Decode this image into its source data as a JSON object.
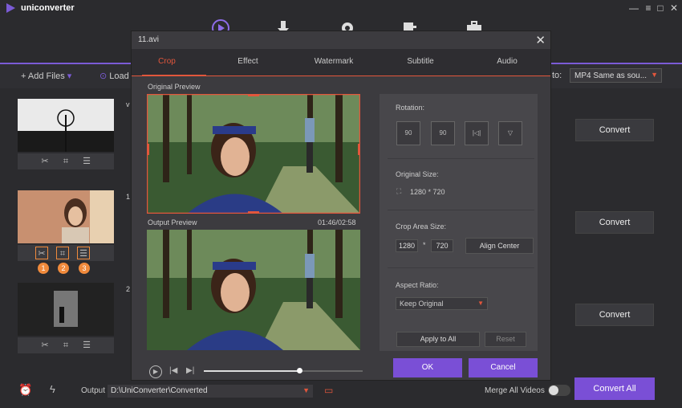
{
  "app": {
    "name": "uniconverter",
    "window_controls": [
      "—",
      "□",
      "✕"
    ]
  },
  "toolbar": {
    "add_files": "Add Files",
    "load": "Load",
    "output_to_label": "to:",
    "output_format": "MP4 Same as sou..."
  },
  "list": [
    {
      "title": "v",
      "convert": "Convert"
    },
    {
      "title": "1",
      "convert": "Convert"
    },
    {
      "title": "2",
      "convert": "Convert"
    }
  ],
  "badges": [
    "1",
    "2",
    "3"
  ],
  "dialog": {
    "title": "11.avi",
    "tabs": [
      "Crop",
      "Effect",
      "Watermark",
      "Subtitle",
      "Audio"
    ],
    "original_preview": "Original Preview",
    "output_preview": "Output Preview",
    "time": "01:46/02:58",
    "progress": 0.6,
    "rotation_label": "Rotation:",
    "rotation_buttons": [
      "90",
      "90",
      "|◁|",
      "▽"
    ],
    "original_size_label": "Original Size:",
    "original_size": "1280 * 720",
    "crop_area_label": "Crop Area Size:",
    "crop_w": "1280",
    "crop_times": "*",
    "crop_h": "720",
    "align_center": "Align Center",
    "aspect_label": "Aspect Ratio:",
    "aspect_value": "Keep Original",
    "apply_all": "Apply to All",
    "reset": "Reset",
    "ok": "OK",
    "cancel": "Cancel"
  },
  "bottom": {
    "output_label": "Output",
    "output_path": "D:\\UniConverter\\Converted",
    "merge": "Merge All Videos",
    "convert_all": "Convert All"
  },
  "colors": {
    "accent": "#e2563c",
    "purple": "#7a4fd6",
    "badge": "#f08a3c"
  }
}
